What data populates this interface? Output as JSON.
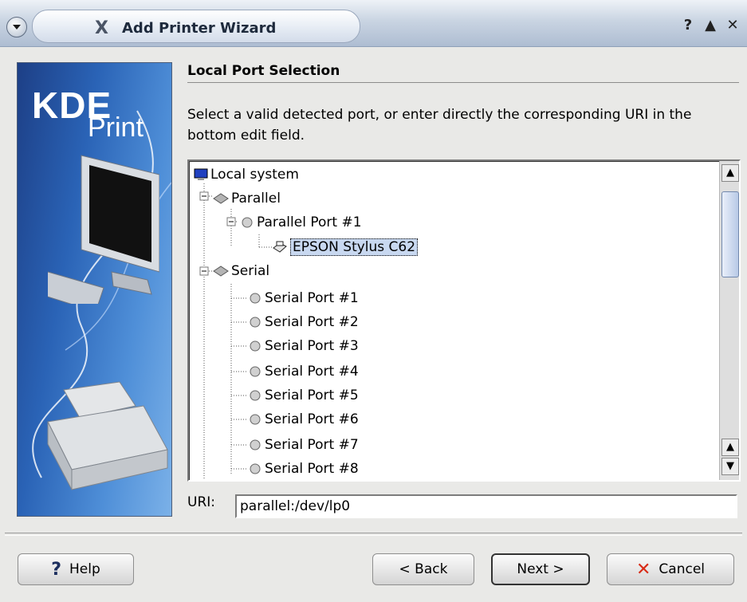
{
  "window": {
    "title": "Add Printer Wizard",
    "controls": [
      "help-icon",
      "maximize-icon",
      "close-icon"
    ]
  },
  "sidebar": {
    "logo_top": "KDE",
    "logo_bottom": "Print"
  },
  "page": {
    "heading": "Local Port Selection",
    "description": "Select a valid detected port, or enter directly the corresponding URI in the bottom edit field."
  },
  "tree": {
    "items": [
      {
        "label": "Local system",
        "icon": "computer-icon"
      },
      {
        "label": "Parallel",
        "icon": "port-group-icon"
      },
      {
        "label": "Parallel Port #1",
        "icon": "port-icon"
      },
      {
        "label": "EPSON Stylus C62",
        "icon": "printer-icon",
        "selected": true
      },
      {
        "label": "Serial",
        "icon": "port-group-icon"
      },
      {
        "label": "Serial Port #1",
        "icon": "port-icon"
      },
      {
        "label": "Serial Port #2",
        "icon": "port-icon"
      },
      {
        "label": "Serial Port #3",
        "icon": "port-icon"
      },
      {
        "label": "Serial Port #4",
        "icon": "port-icon"
      },
      {
        "label": "Serial Port #5",
        "icon": "port-icon"
      },
      {
        "label": "Serial Port #6",
        "icon": "port-icon"
      },
      {
        "label": "Serial Port #7",
        "icon": "port-icon"
      },
      {
        "label": "Serial Port #8",
        "icon": "port-icon"
      }
    ]
  },
  "uri": {
    "label": "URI:",
    "value": "parallel:/dev/lp0"
  },
  "buttons": {
    "help_label": "Help",
    "back_label": "< Back",
    "next_label": "Next >",
    "cancel_label": "Cancel"
  }
}
